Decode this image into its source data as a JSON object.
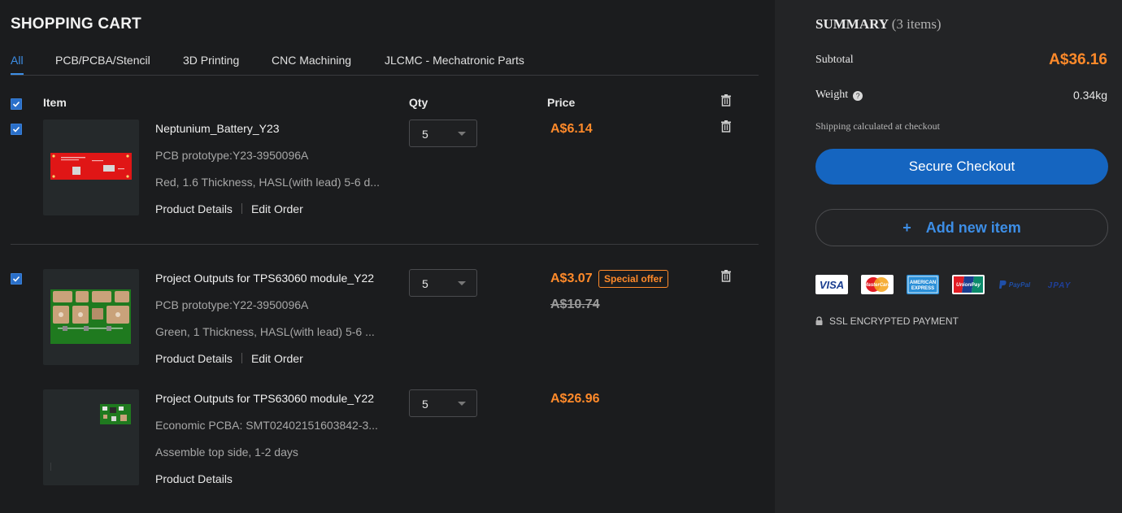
{
  "header": {
    "title": "SHOPPING CART"
  },
  "tabs": [
    {
      "label": "All",
      "active": true
    },
    {
      "label": "PCB/PCBA/Stencil"
    },
    {
      "label": "3D Printing"
    },
    {
      "label": "CNC Machining"
    },
    {
      "label": "JLCMC - Mechatronic Parts"
    }
  ],
  "columns": {
    "item": "Item",
    "qty": "Qty",
    "price": "Price"
  },
  "items": [
    {
      "name": "Neptunium_Battery_Y23",
      "line1": "PCB prototype:Y23-3950096A",
      "line2": "Red, 1.6 Thickness, HASL(with lead) 5-6 d...",
      "details": "Product Details",
      "edit": "Edit Order",
      "qty": "5",
      "price": "A$6.14"
    },
    {
      "name": "Project Outputs for TPS63060 module_Y22",
      "line1": "PCB prototype:Y22-3950096A",
      "line2": "Green, 1 Thickness, HASL(with lead) 5-6 ...",
      "details": "Product Details",
      "edit": "Edit Order",
      "qty": "5",
      "price": "A$3.07",
      "offer": "Special offer",
      "old_price": "A$10.74"
    },
    {
      "name": "Project Outputs for TPS63060 module_Y22",
      "line1": "Economic PCBA: SMT02402151603842-3...",
      "line2": "Assemble top side, 1-2 days",
      "details": "Product Details",
      "qty": "5",
      "price": "A$26.96"
    }
  ],
  "summary": {
    "title": "SUMMARY",
    "count": "(3 items)",
    "subtotal_label": "Subtotal",
    "subtotal": "A$36.16",
    "weight_label": "Weight",
    "weight": "0.34kg",
    "shipping_note": "Shipping calculated at checkout",
    "checkout": "Secure Checkout",
    "add_plus": "+",
    "add": "Add new item",
    "ssl": "SSL ENCRYPTED PAYMENT"
  },
  "payment_cards": {
    "visa": "VISA",
    "mastercard": "MasterCard",
    "amex_1": "AMERICAN",
    "amex_2": "EXPRESS",
    "unionpay": "UnionPay",
    "paypal": "PayPal",
    "jpay": "JPAY"
  },
  "colors": {
    "accent_blue": "#3d8ee6",
    "checkout_blue": "#1565c0",
    "price_orange": "#ff8a2a",
    "background": "#1b1c1e"
  }
}
